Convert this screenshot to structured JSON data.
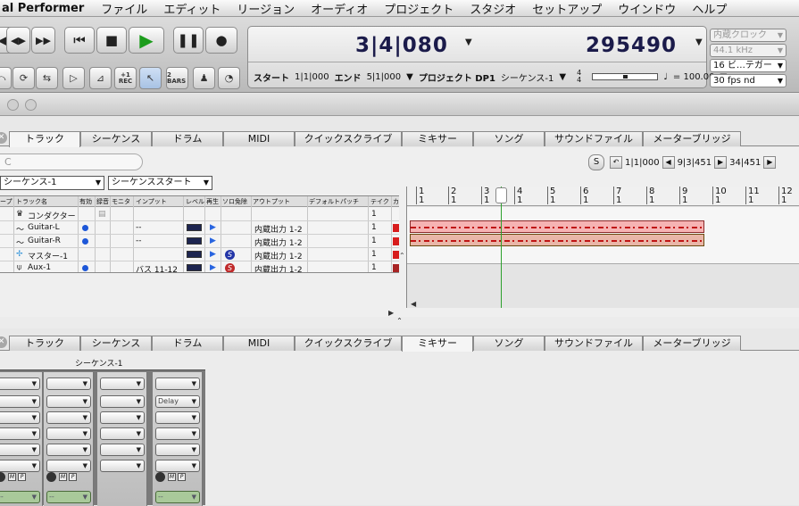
{
  "menubar": {
    "app_name": "al Performer",
    "items": [
      "ファイル",
      "エディット",
      "リージョン",
      "オーディオ",
      "プロジェクト",
      "スタジオ",
      "セットアップ",
      "ウインドウ",
      "ヘルプ"
    ]
  },
  "toolbar": {
    "transport": [
      "rewind-icon",
      "forward-icon",
      "fast-forward-icon",
      "skip-back-icon",
      "stop-icon",
      "play-icon",
      "pause-icon",
      "record-icon"
    ],
    "small_buttons": [
      {
        "icon": "auto-rewind-icon",
        "label": ""
      },
      {
        "icon": "memory-cycle-icon",
        "label": ""
      },
      {
        "icon": "shuttle-icon",
        "label": ""
      },
      {
        "icon": "wait-icon",
        "label": ""
      },
      {
        "icon": "metronome-icon",
        "label": ""
      },
      {
        "icon": "rec-icon",
        "label": "REC"
      },
      {
        "icon": "pointer-icon",
        "label": ""
      },
      {
        "icon": "bars-icon",
        "label": "2 BARS"
      },
      {
        "icon": "countoff-icon",
        "label": ""
      },
      {
        "icon": "clock-icon",
        "label": ""
      }
    ],
    "counter": {
      "main_time": "3|4|080",
      "samples": "295490",
      "start_label": "スタート",
      "start_value": "1|1|000",
      "end_label": "エンド",
      "end_value": "5|1|000",
      "project_label": "プロジェクト DP1",
      "sequence": "シーケンス-1",
      "time_sig_top": "4",
      "time_sig_bottom": "4",
      "tempo": "= 100.00"
    },
    "settings": [
      "内蔵クロック",
      "44.1 kHz",
      "16 ビ…テガー",
      "30 fps nd"
    ]
  },
  "tabs_top": [
    "トラック",
    "シーケンス",
    "ドラム",
    "MIDI",
    "クイックスクライブ",
    "ミキサー",
    "ソング",
    "サウンドファイル",
    "メーターブリッジ"
  ],
  "tabs_bottom": [
    "トラック",
    "シーケンス",
    "ドラム",
    "MIDI",
    "クイックスクライブ",
    "ミキサー",
    "ソング",
    "サウンドファイル",
    "メーターブリッジ"
  ],
  "tracks_window": {
    "search_placeholder": "C",
    "sequence_select": "シーケンス-1",
    "start_select": "シーケンススタート",
    "nav_s": "S",
    "nav_start": "1|1|000",
    "nav_mid": "9|3|451",
    "nav_end": "34|451",
    "columns": [
      "ープ",
      "トラック名",
      "有効",
      "録音",
      "モニタ",
      "インプット",
      "レベル",
      "再生",
      "ソロ免除",
      "アウトプット",
      "デフォルトパッチ",
      "テイク",
      "カ"
    ],
    "rows": [
      {
        "name": "コンダクター",
        "input": "",
        "output": "",
        "take": "1"
      },
      {
        "name": "Guitar-L",
        "input": "--",
        "output": "内蔵出力 1-2",
        "take": "1"
      },
      {
        "name": "Guitar-R",
        "input": "--",
        "output": "内蔵出力 1-2",
        "take": "1"
      },
      {
        "name": "マスター-1",
        "input": "",
        "output": "内蔵出力 1-2",
        "take": "1"
      },
      {
        "name": "Aux-1",
        "input": "バス 11-12",
        "output": "内蔵出力 1-2",
        "take": "1"
      }
    ],
    "ruler_bars": [
      "1",
      "2",
      "3",
      "4",
      "5",
      "6",
      "7",
      "8",
      "9",
      "10",
      "11",
      "12"
    ],
    "ruler_beats": [
      "1",
      "1",
      "1",
      "1",
      "1",
      "1",
      "1",
      "1",
      "1",
      "1",
      "1",
      "1"
    ]
  },
  "mixer": {
    "sequence_label": "シーケンス-1",
    "insert_label": "Delay",
    "mute": "M",
    "pre": "P",
    "output_placeholder": "--"
  }
}
